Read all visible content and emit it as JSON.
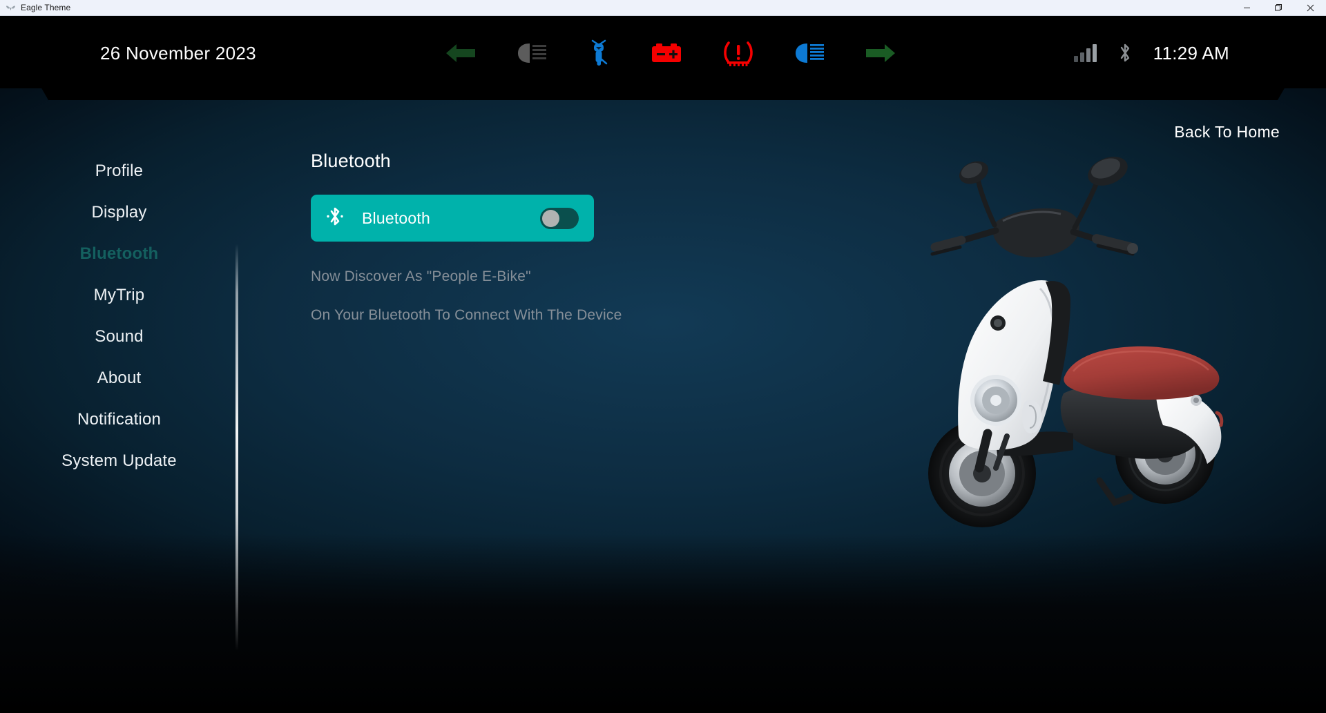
{
  "window": {
    "title": "Eagle Theme",
    "app_icon": "eagle-logo-icon",
    "controls": {
      "minimize": "—",
      "maximize": "❐",
      "close": "✕"
    }
  },
  "statusbar": {
    "date": "26 November 2023",
    "time": "11:29 AM",
    "indicators": [
      {
        "name": "left-turn-signal-icon",
        "color": "#15461f",
        "state": "inactive"
      },
      {
        "name": "low-beam-icon",
        "color": "#5c5c5c",
        "state": "inactive"
      },
      {
        "name": "scooter-icon",
        "color": "#0d7ad4",
        "state": "active"
      },
      {
        "name": "battery-warning-icon",
        "color": "#f50000",
        "state": "active"
      },
      {
        "name": "tire-pressure-warning-icon",
        "color": "#f50000",
        "state": "active"
      },
      {
        "name": "high-beam-icon",
        "color": "#0d7ad4",
        "state": "active"
      },
      {
        "name": "right-turn-signal-icon",
        "color": "#1a5c24",
        "state": "inactive"
      }
    ],
    "signal_icon": "signal-bars-icon",
    "signal_bars": 4,
    "bluetooth_icon": "bluetooth-icon"
  },
  "back_to_home": "Back To Home",
  "sidebar": {
    "items": [
      {
        "label": "Profile",
        "active": false
      },
      {
        "label": "Display",
        "active": false
      },
      {
        "label": "Bluetooth",
        "active": true
      },
      {
        "label": "MyTrip",
        "active": false
      },
      {
        "label": "Sound",
        "active": false
      },
      {
        "label": "About",
        "active": false
      },
      {
        "label": "Notification",
        "active": false
      },
      {
        "label": "System Update",
        "active": false
      }
    ]
  },
  "main": {
    "title": "Bluetooth",
    "card": {
      "icon": "bluetooth-icon",
      "label": "Bluetooth",
      "toggle_state": "off"
    },
    "hints": [
      "Now Discover As \"People E-Bike\"",
      "On Your Bluetooth To Connect With The Device"
    ]
  },
  "colors": {
    "accent_teal": "#00b2ab",
    "toggle_track": "#0a4f4d",
    "toggle_knob": "#b1b3b2",
    "active_nav": "#14605f",
    "hint_text": "#868f98",
    "background_top": "#123a55",
    "background_bottom": "#020509",
    "scooter_body": "#f3f4f5",
    "scooter_seat": "#a63e3a"
  },
  "illustration": {
    "name": "electric-scooter-image",
    "alt": "White electric scooter with red seat"
  }
}
